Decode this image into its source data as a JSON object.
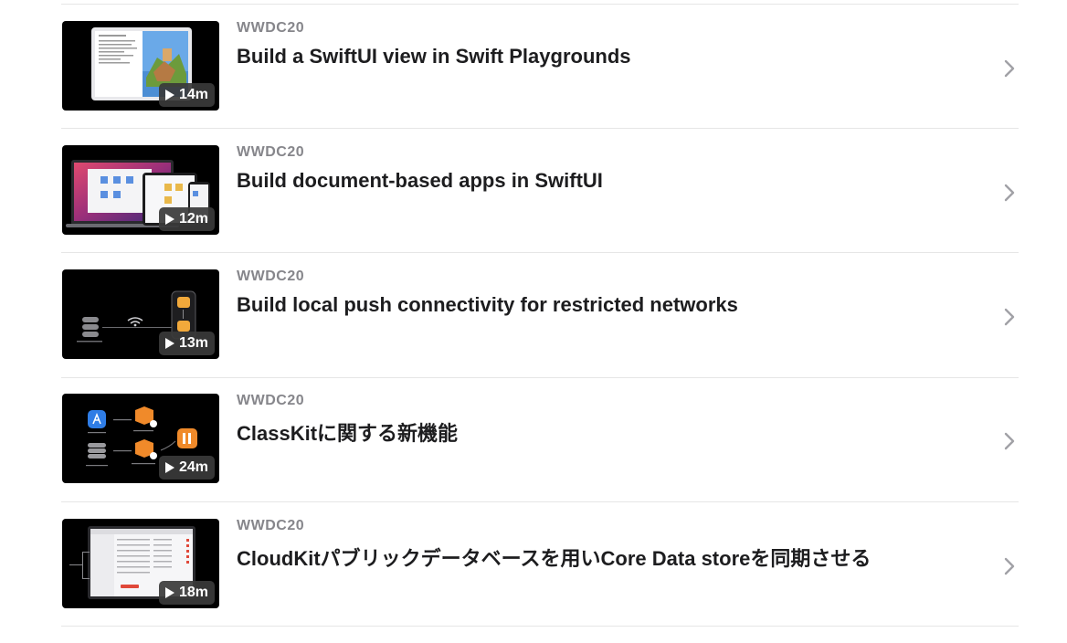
{
  "sessions": [
    {
      "event": "WWDC20",
      "title": "Build a SwiftUI view in Swift Playgrounds",
      "duration": "14m",
      "thumbnail_icon": "ipad-playgrounds-thumbnail"
    },
    {
      "event": "WWDC20",
      "title": "Build document-based apps in SwiftUI",
      "duration": "12m",
      "thumbnail_icon": "devices-document-apps-thumbnail"
    },
    {
      "event": "WWDC20",
      "title": "Build local push connectivity for restricted networks",
      "duration": "13m",
      "thumbnail_icon": "network-diagram-thumbnail"
    },
    {
      "event": "WWDC20",
      "title": "ClassKitに関する新機能",
      "duration": "24m",
      "thumbnail_icon": "classkit-diagram-thumbnail"
    },
    {
      "event": "WWDC20",
      "title": "CloudKitパブリックデータベースを用いCore Data storeを同期させる",
      "duration": "18m",
      "thumbnail_icon": "cloudkit-screen-thumbnail"
    }
  ],
  "colors": {
    "accent": "#86868b",
    "title": "#1d1d1f",
    "divider": "#e6e6e6",
    "chevron": "#a1a1a6"
  }
}
